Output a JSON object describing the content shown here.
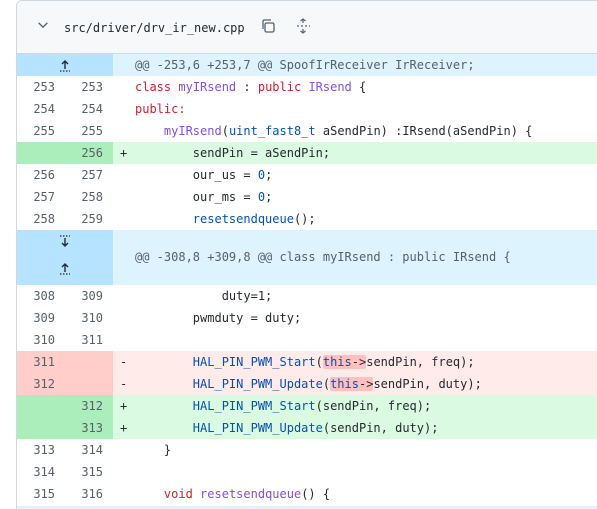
{
  "file": {
    "path": "src/driver/drv_ir_new.cpp",
    "icons": [
      "chevron-down-icon",
      "copy-icon",
      "expand-all-icon"
    ]
  },
  "hunks": [
    {
      "header": "@@ -253,6 +253,7 @@ SpoofIrReceiver IrReceiver;",
      "icon": "expand-up-icon"
    },
    {
      "header": "@@ -308,8 +309,8 @@ class myIRsend : public IRsend {",
      "icons": [
        "expand-down-icon",
        "expand-up-icon"
      ]
    }
  ],
  "lines": [
    {
      "old": "253",
      "new": "253",
      "sign": "",
      "text": "class myIRsend : public IRsend {"
    },
    {
      "old": "254",
      "new": "254",
      "sign": "",
      "text": "public:"
    },
    {
      "old": "255",
      "new": "255",
      "sign": "",
      "text": "    myIRsend(uint_fast8_t aSendPin) :IRsend(aSendPin) {"
    },
    {
      "old": "",
      "new": "256",
      "sign": "+",
      "text": "        sendPin = aSendPin;"
    },
    {
      "old": "256",
      "new": "257",
      "sign": "",
      "text": "        our_us = 0;"
    },
    {
      "old": "257",
      "new": "258",
      "sign": "",
      "text": "        our_ms = 0;"
    },
    {
      "old": "258",
      "new": "259",
      "sign": "",
      "text": "        resetsendqueue();"
    },
    {
      "old": "308",
      "new": "309",
      "sign": "",
      "text": "            duty=1;"
    },
    {
      "old": "309",
      "new": "310",
      "sign": "",
      "text": "        pwmduty = duty;"
    },
    {
      "old": "310",
      "new": "311",
      "sign": "",
      "text": ""
    },
    {
      "old": "311",
      "new": "",
      "sign": "-",
      "text": "        HAL_PIN_PWM_Start(this->sendPin, freq);"
    },
    {
      "old": "312",
      "new": "",
      "sign": "-",
      "text": "        HAL_PIN_PWM_Update(this->sendPin, duty);"
    },
    {
      "old": "",
      "new": "312",
      "sign": "+",
      "text": "        HAL_PIN_PWM_Start(sendPin, freq);"
    },
    {
      "old": "",
      "new": "313",
      "sign": "+",
      "text": "        HAL_PIN_PWM_Update(sendPin, duty);"
    },
    {
      "old": "313",
      "new": "314",
      "sign": "",
      "text": "    }"
    },
    {
      "old": "314",
      "new": "315",
      "sign": "",
      "text": ""
    },
    {
      "old": "315",
      "new": "316",
      "sign": "",
      "text": "    void resetsendqueue() {"
    }
  ],
  "colors": {
    "hunk_gutter": "#b6e3ff",
    "hunk_body": "#ddf4ff",
    "add_gutter": "#aceebb",
    "add_body": "#dafbe1",
    "del_gutter": "#ffcecb",
    "del_body": "#ffebe9"
  }
}
